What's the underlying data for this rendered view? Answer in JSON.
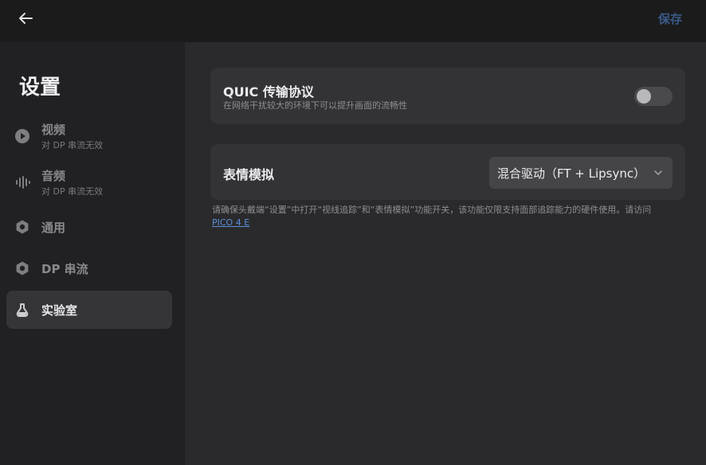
{
  "header": {
    "back_icon": "arrow-left-icon",
    "save_label": "保存"
  },
  "sidebar": {
    "title": "设置",
    "items": [
      {
        "label": "视频",
        "sub": "对 DP 串流无效",
        "icon": "play-circle-icon"
      },
      {
        "label": "音频",
        "sub": "对 DP 串流无效",
        "icon": "waveform-icon"
      },
      {
        "label": "通用",
        "sub": "",
        "icon": "gear-icon"
      },
      {
        "label": "DP 串流",
        "sub": "",
        "icon": "gear-icon"
      },
      {
        "label": "实验室",
        "sub": "",
        "icon": "flask-icon"
      }
    ],
    "active_index": 4
  },
  "main": {
    "quic": {
      "title": "QUIC 传输协议",
      "description": "在网络干扰较大的环境下可以提升画面的流畅性",
      "enabled": false
    },
    "face_sim": {
      "title": "表情模拟",
      "selected_option": "混合驱动（FT + Lipsync）"
    },
    "note": {
      "text": "请确保头戴端“设置”中打开“视线追踪”和“表情模拟”功能开关，该功能仅限支持面部追踪能力的硬件使用。请访问",
      "link": "PICO 4 E"
    }
  },
  "colors": {
    "background": "#2a2a2c",
    "sidebar": "#212123",
    "topbar": "#1b1b1c",
    "card": "#333335",
    "link": "#5b8fd9",
    "save": "#3a5a86"
  }
}
